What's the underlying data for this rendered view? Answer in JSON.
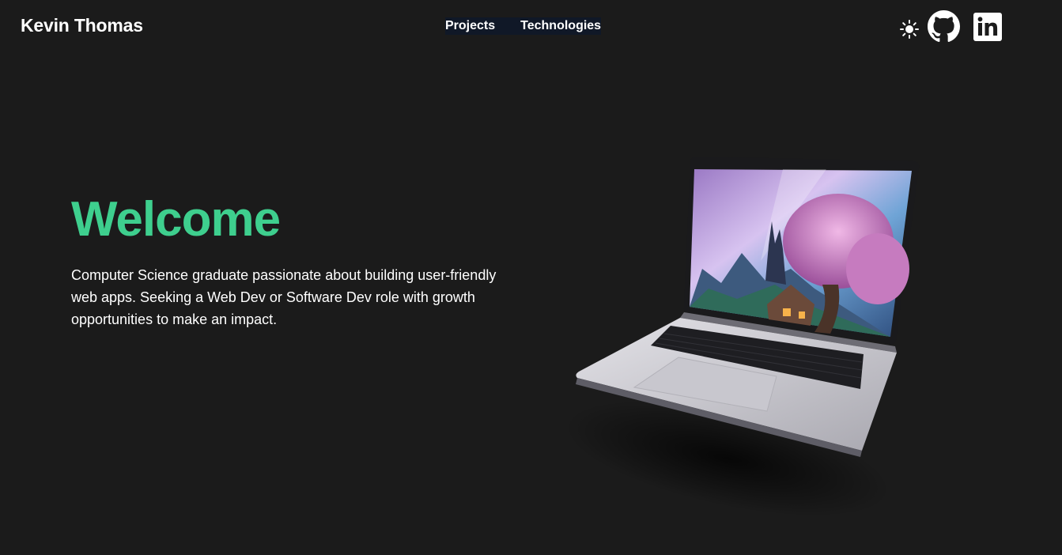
{
  "header": {
    "brand": "Kevin Thomas",
    "nav": [
      {
        "label": "Projects"
      },
      {
        "label": "Technologies"
      }
    ],
    "icons": [
      "sun-icon",
      "github-icon",
      "linkedin-icon"
    ]
  },
  "hero": {
    "title": "Welcome",
    "intro": "Computer Science graduate passionate about building user-friendly web apps. Seeking a Web Dev or Software Dev role with growth opportunities to make an impact."
  },
  "colors": {
    "background": "#1b1b1b",
    "accent": "#3ecf8e",
    "nav_background": "#101827",
    "text": "#ffffff"
  }
}
